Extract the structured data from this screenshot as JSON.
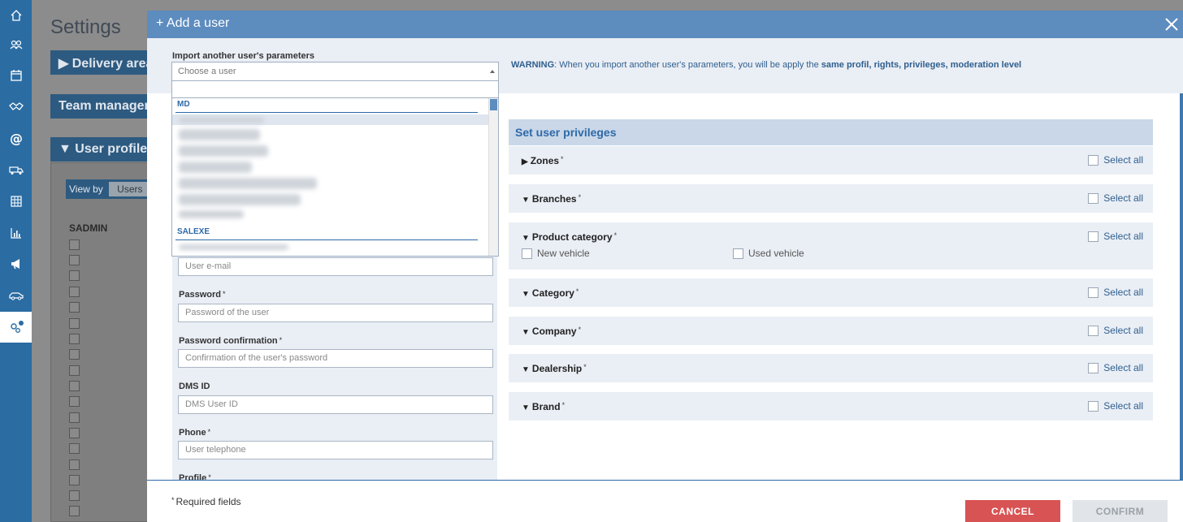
{
  "background": {
    "page_title": "Settings",
    "sections": [
      "▶ Delivery area",
      "Team managem",
      "▼ User profiles :"
    ],
    "view_by_label": "View by",
    "view_by_value": "Users",
    "group_label": "SADMIN"
  },
  "sidebar": {
    "icons": [
      "home-icon",
      "people-icon",
      "calendar-icon",
      "handshake-icon",
      "at-icon",
      "truck-icon",
      "table-icon",
      "bar-chart-icon",
      "megaphone-icon",
      "car-icon",
      "gears-icon"
    ]
  },
  "modal": {
    "title": "+ Add a user",
    "import": {
      "label": "Import another user's parameters",
      "placeholder": "Choose a user",
      "groups": [
        "MD",
        "SALEXE"
      ]
    },
    "warning": {
      "prefix": "WARNING",
      "text": ": When you import another user's parameters, you will be apply the ",
      "bold": "same profil, rights, privileges, moderation level"
    },
    "fields": {
      "email_placeholder": "User e-mail",
      "password_label": "Password",
      "password_placeholder": "Password of the user",
      "password_confirm_label": "Password confirmation",
      "password_confirm_placeholder": "Confirmation of the user's password",
      "dms_label": "DMS ID",
      "dms_placeholder": "DMS User ID",
      "phone_label": "Phone",
      "phone_placeholder": "User telephone",
      "profile_label": "Profile",
      "required_mark": "*"
    },
    "privileges": {
      "title": "Set user privileges",
      "select_all": "Select all",
      "rows": [
        {
          "name": "Zones",
          "tri": "▶"
        },
        {
          "name": "Branches",
          "tri": "▼"
        },
        {
          "name": "Product category",
          "tri": "▼",
          "options": [
            "New vehicle",
            "Used vehicle"
          ]
        },
        {
          "name": "Category",
          "tri": "▼"
        },
        {
          "name": "Company",
          "tri": "▼"
        },
        {
          "name": "Dealership",
          "tri": "▼"
        },
        {
          "name": "Brand",
          "tri": "▼"
        }
      ]
    },
    "footer": {
      "required_note": "Required fields",
      "cancel_label": "CANCEL",
      "confirm_label": "CONFIRM"
    }
  },
  "colors": {
    "sidebar": "#2b6ca3",
    "header": "#5d8cbf",
    "cancel": "#d85353",
    "link": "#2e6aa8"
  }
}
